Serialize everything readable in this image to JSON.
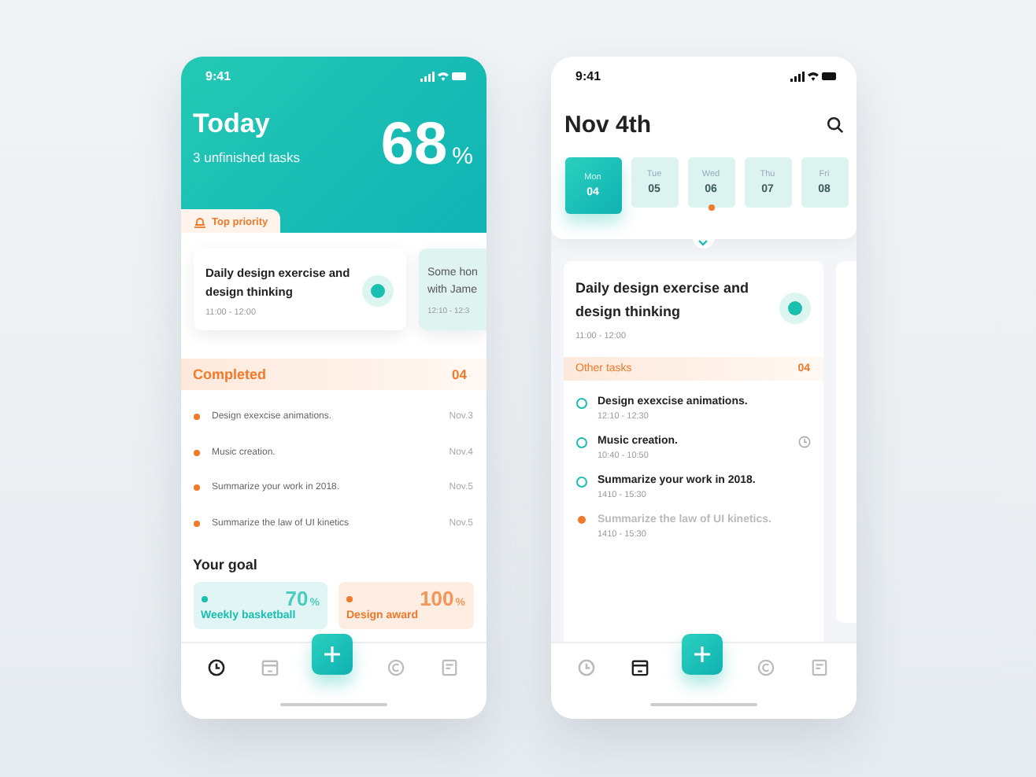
{
  "home_screen": {
    "status_time": "9:41",
    "title": "Today",
    "subtitle": "3 unfinished tasks",
    "progress_value": "68",
    "progress_unit": "%",
    "priority_tab": "Top priority",
    "priority_cards": [
      {
        "kind": "main",
        "title": "Daily design exercise and design thinking",
        "time": "11:00 - 12:00"
      },
      {
        "kind": "peek",
        "title": "Some hon with Jame",
        "time": "12:10 - 12:3"
      }
    ],
    "completed": {
      "title": "Completed",
      "count": "04",
      "items": [
        {
          "text": "Design exexcise animations.",
          "date": "Nov.3"
        },
        {
          "text": "Music creation.",
          "date": "Nov.4"
        },
        {
          "text": "Summarize your work in 2018.",
          "date": "Nov.5"
        },
        {
          "text": "Summarize the law of UI kinetics",
          "date": "Nov.5"
        }
      ]
    },
    "goal": {
      "title": "Your goal",
      "items": [
        {
          "label": "Weekly basketball",
          "value": "70",
          "unit": "%",
          "color": "#1bbfb0"
        },
        {
          "label": "Design award",
          "value": "100",
          "unit": "%",
          "color": "#f07a2a"
        }
      ]
    },
    "nav": [
      {
        "kind": "clock",
        "selected": true
      },
      {
        "kind": "calendar",
        "selected": false
      },
      {
        "kind": "add",
        "selected": false
      },
      {
        "kind": "copyright",
        "selected": false
      },
      {
        "kind": "note",
        "selected": false
      }
    ]
  },
  "calendar_screen": {
    "status_time": "9:41",
    "title": "Nov 4th",
    "days": [
      {
        "weekday": "Mon",
        "day": "04",
        "selected": true,
        "marked": false
      },
      {
        "weekday": "Tue",
        "day": "05",
        "selected": false,
        "marked": false
      },
      {
        "weekday": "Wed",
        "day": "06",
        "selected": false,
        "marked": true
      },
      {
        "weekday": "Thu",
        "day": "07",
        "selected": false,
        "marked": false
      },
      {
        "weekday": "Fri",
        "day": "08",
        "selected": false,
        "marked": false
      }
    ],
    "main_task": {
      "title": "Daily design exercise and design thinking",
      "time": "11:00 - 12:00"
    },
    "other_tasks": {
      "title": "Other tasks",
      "count": "04",
      "items": [
        {
          "text": "Design exexcise animations.",
          "time": "12:10 - 12:30",
          "disabled": false,
          "reminder": false
        },
        {
          "text": "Music creation.",
          "time": "10:40 - 10:50",
          "disabled": false,
          "reminder": true
        },
        {
          "text": "Summarize your work in 2018.",
          "time": "1410 - 15:30",
          "disabled": false,
          "reminder": false
        },
        {
          "text": "Summarize the law of UI kinetics.",
          "time": "1410 - 15:30",
          "disabled": true,
          "reminder": false
        }
      ]
    },
    "nav": [
      {
        "kind": "clock",
        "selected": false
      },
      {
        "kind": "calendar",
        "selected": true
      },
      {
        "kind": "add",
        "selected": false
      },
      {
        "kind": "copyright",
        "selected": false
      },
      {
        "kind": "note",
        "selected": false
      }
    ]
  }
}
